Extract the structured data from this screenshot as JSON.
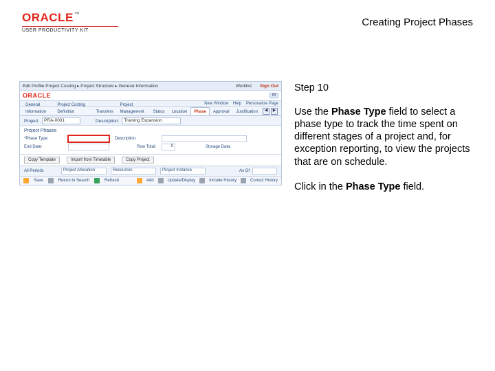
{
  "branding": {
    "name": "ORACLE",
    "tm": "™",
    "tagline": "USER PRODUCTIVITY KIT"
  },
  "doc_title": "Creating Project Phases",
  "step": {
    "label": "Step 10",
    "para1_pre": "Use the ",
    "para1_b1": "Phase Type",
    "para1_post": " field to select a phase type to track the time spent on different stages of a project and, for exception reporting, to view the projects that are on schedule.",
    "para2_pre": "Click in the ",
    "para2_b1": "Phase Type",
    "para2_post": " field."
  },
  "screenshot": {
    "top": {
      "title_left": "Edit Profile    Project Costing ▸  Project Structure ▸  General Information",
      "right_text": "Worklist",
      "logout": "Sign Out"
    },
    "brand_row": {
      "brand": "ORACLE",
      "pill": "M"
    },
    "subbar": {
      "items": [
        "New Window",
        "Help",
        "Personalize Page"
      ]
    },
    "tabs": [
      {
        "label": "General Information",
        "active": false
      },
      {
        "label": "Project Costing Definition",
        "active": false
      },
      {
        "label": "Transfers",
        "active": false
      },
      {
        "label": "Project Management",
        "active": false
      },
      {
        "label": "Status",
        "active": false
      },
      {
        "label": "Location",
        "active": false
      },
      {
        "label": "Phase",
        "active": true
      },
      {
        "label": "Approval",
        "active": false
      },
      {
        "label": "Justification",
        "active": false
      }
    ],
    "nav_arrows": {
      "left": "◀",
      "right": "▶"
    },
    "proj_row": {
      "label": "Project:",
      "value": "PRA-0001",
      "desc_label": "Description:",
      "desc_value": "Training Expansion"
    },
    "phase_section_title": "Project Phases",
    "phase_grid": {
      "r1c1_lbl": "*Phase Type:",
      "r1c1_val": "",
      "r1c2_lbl": "Description:",
      "r1c2_val": "",
      "r2c1_lbl": "End Date:",
      "r2c1_val": "",
      "r2c2_lbl": "Row Total:",
      "r2c2_val": "0",
      "r2c3_lbl": "Storage Data:",
      "r2c3_val": ""
    },
    "buttons": {
      "b1": "Copy Template",
      "b2": "Import from Timetable",
      "b3": "Copy Project"
    },
    "section2": {
      "title": "All Periods",
      "col1": "Project Allocation",
      "col2": "Resources",
      "col3": "Project Instance",
      "after_lbl": "As Of",
      "after_val": ""
    },
    "footer": {
      "f1": "Save",
      "f2": "Return to Search",
      "f3": "Refresh",
      "f4": "Add",
      "f5": "Update/Display",
      "f6": "Include History",
      "f7": "Correct History"
    }
  }
}
